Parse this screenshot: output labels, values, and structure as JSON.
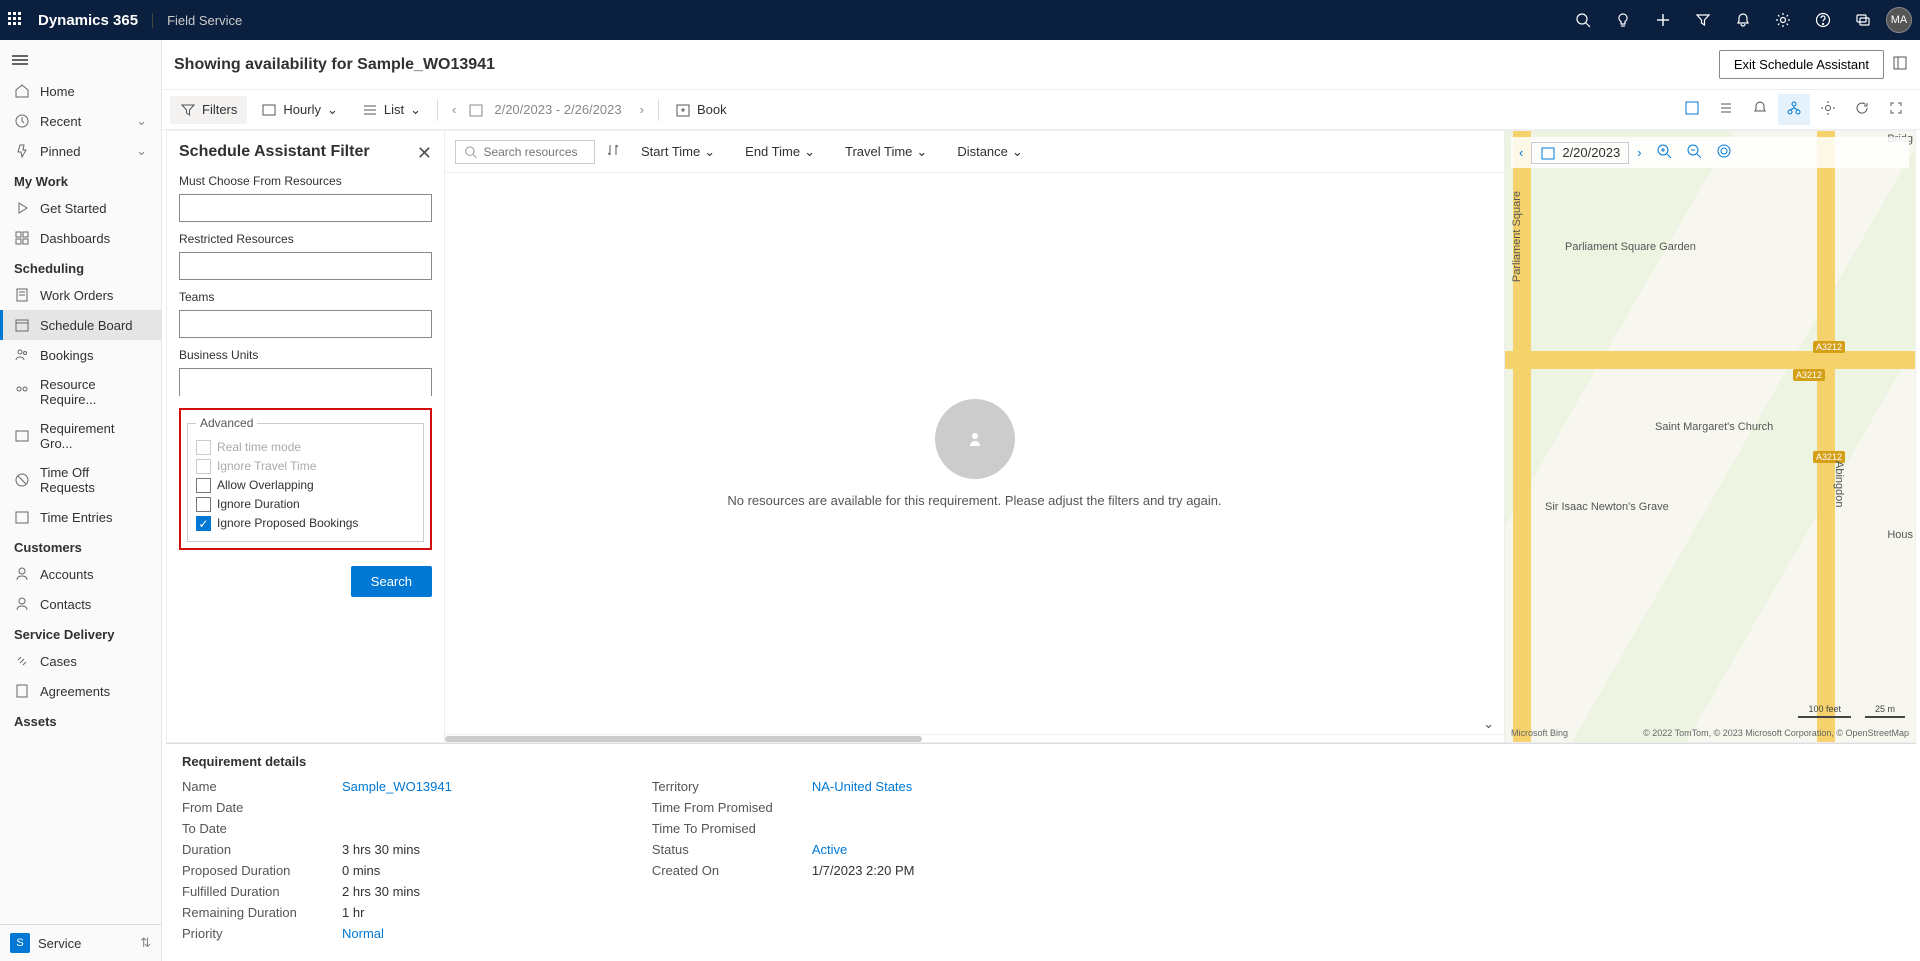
{
  "topbar": {
    "brand": "Dynamics 365",
    "app_name": "Field Service",
    "avatar": "MA"
  },
  "sidebar": {
    "home": "Home",
    "recent": "Recent",
    "pinned": "Pinned",
    "sections": {
      "my_work": "My Work",
      "scheduling": "Scheduling",
      "customers": "Customers",
      "service_delivery": "Service Delivery",
      "assets": "Assets"
    },
    "items": {
      "get_started": "Get Started",
      "dashboards": "Dashboards",
      "work_orders": "Work Orders",
      "schedule_board": "Schedule Board",
      "bookings": "Bookings",
      "resource_req": "Resource Require...",
      "req_groups": "Requirement Gro...",
      "time_off": "Time Off Requests",
      "time_entries": "Time Entries",
      "accounts": "Accounts",
      "contacts": "Contacts",
      "cases": "Cases",
      "agreements": "Agreements"
    },
    "app_switch": {
      "tile": "S",
      "label": "Service"
    }
  },
  "titlebar": {
    "heading": "Showing availability for Sample_WO13941",
    "exit_btn": "Exit Schedule Assistant"
  },
  "cmdbar": {
    "filters": "Filters",
    "hourly": "Hourly",
    "list": "List",
    "date_range": "2/20/2023 - 2/26/2023",
    "book": "Book"
  },
  "filter_panel": {
    "title": "Schedule Assistant Filter",
    "must_choose": "Must Choose From Resources",
    "restricted": "Restricted Resources",
    "teams": "Teams",
    "business_units": "Business Units",
    "advanced_legend": "Advanced",
    "real_time": "Real time mode",
    "ignore_travel": "Ignore Travel Time",
    "allow_overlap": "Allow Overlapping",
    "ignore_duration": "Ignore Duration",
    "ignore_proposed": "Ignore Proposed Bookings",
    "search_btn": "Search"
  },
  "results": {
    "search_ph": "Search resources",
    "cols": {
      "start": "Start Time",
      "end": "End Time",
      "travel": "Travel Time",
      "dist": "Distance"
    },
    "empty_msg": "No resources are available for this requirement. Please adjust the filters and try again."
  },
  "map": {
    "date": "2/20/2023",
    "label_parliament": "Parliament Square Garden",
    "label_church": "Saint Margaret's Church",
    "label_newton": "Sir Isaac Newton's Grave",
    "label_bridge": "Bridg",
    "label_hous": "Hous",
    "street_parliament_sq": "Parliament Square",
    "street_abingdon": "Abingdon",
    "badge_a3212": "A3212",
    "scale_ft": "100 feet",
    "scale_m": "25 m",
    "attrib": "© 2022 TomTom, © 2023 Microsoft Corporation, © OpenStreetMap",
    "logo": "Microsoft Bing"
  },
  "req": {
    "heading": "Requirement details",
    "left": {
      "name_l": "Name",
      "name_v": "Sample_WO13941",
      "from_l": "From Date",
      "from_v": "",
      "to_l": "To Date",
      "to_v": "",
      "dur_l": "Duration",
      "dur_v": "3 hrs 30 mins",
      "prop_l": "Proposed Duration",
      "prop_v": "0 mins",
      "fulf_l": "Fulfilled Duration",
      "fulf_v": "2 hrs 30 mins",
      "rem_l": "Remaining Duration",
      "rem_v": "1 hr",
      "prio_l": "Priority",
      "prio_v": "Normal"
    },
    "right": {
      "terr_l": "Territory",
      "terr_v": "NA-United States",
      "tfp_l": "Time From Promised",
      "tfp_v": "",
      "ttp_l": "Time To Promised",
      "ttp_v": "",
      "stat_l": "Status",
      "stat_v": "Active",
      "cron_l": "Created On",
      "cron_v": "1/7/2023 2:20 PM"
    }
  }
}
